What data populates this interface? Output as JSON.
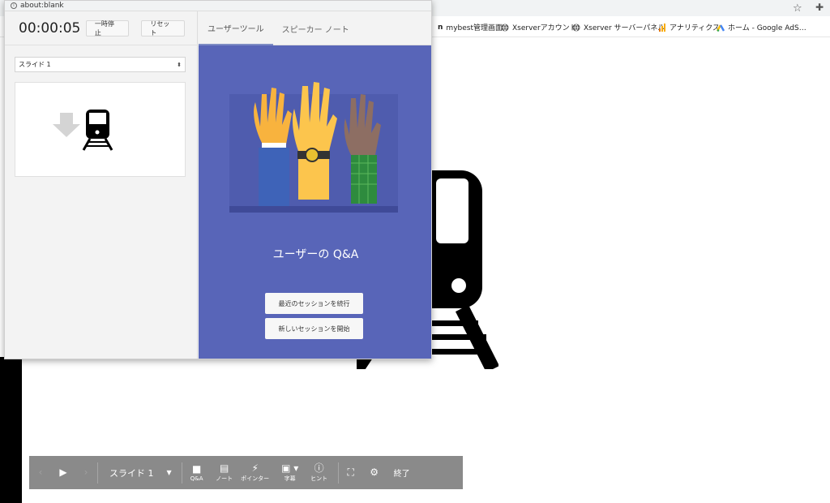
{
  "popup": {
    "url": "about:blank",
    "timer": "00:00:05",
    "pause_label": "一時停止",
    "reset_label": "リセット",
    "slide_select": "スライド 1",
    "tabs": [
      "ユーザーツール",
      "スピーカー ノート"
    ],
    "qa_title": "ユーザーの Q&A",
    "continue_label": "最近のセッションを続行",
    "new_label": "新しいセッションを開始"
  },
  "bookmarks": [
    {
      "label": "mybest管理画面",
      "icon": "text-icon"
    },
    {
      "label": "Xserverアカウント",
      "icon": "globe-icon"
    },
    {
      "label": "Xserver サーバーパネル",
      "icon": "globe-icon"
    },
    {
      "label": "アナリティクス",
      "icon": "analytics-icon"
    },
    {
      "label": "ホーム - Google AdS…",
      "icon": "ads-icon"
    }
  ],
  "controls": {
    "slide_label": "スライド 1",
    "qa_label": "Q&A",
    "notes_label": "ノート",
    "pointer_label": "ポインター",
    "captions_label": "字幕",
    "hint_label": "ヒント",
    "end_label": "終了"
  },
  "colors": {
    "qa_background": "#5865b8",
    "control_bar": "#8a8a8a",
    "tab_underline": "#7e8cc4"
  }
}
